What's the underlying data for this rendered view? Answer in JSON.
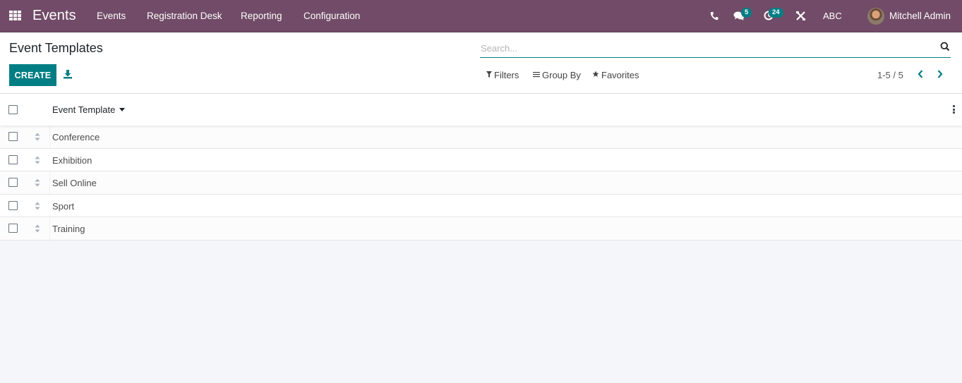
{
  "navbar": {
    "brand": "Events",
    "menu": [
      "Events",
      "Registration Desk",
      "Reporting",
      "Configuration"
    ],
    "messages_badge": "5",
    "activities_badge": "24",
    "company": "ABC",
    "user_name": "Mitchell Admin",
    "icons": [
      "apps-grid-icon",
      "phone-icon",
      "chat-icon",
      "clock-icon",
      "tools-icon"
    ]
  },
  "control_panel": {
    "title": "Event Templates",
    "create_label": "CREATE",
    "download_icon": "download-icon",
    "search": {
      "placeholder": "Search...",
      "value": ""
    },
    "filters_label": "Filters",
    "group_by_label": "Group By",
    "favorites_label": "Favorites",
    "pager_value": "1-5 / 5"
  },
  "list": {
    "columns": [
      {
        "label": "Event Template",
        "sorted": "desc"
      }
    ],
    "rows": [
      {
        "name": "Conference"
      },
      {
        "name": "Exhibition"
      },
      {
        "name": "Sell Online"
      },
      {
        "name": "Sport"
      },
      {
        "name": "Training"
      }
    ]
  },
  "colors": {
    "navbar": "#714b67",
    "primary": "#017e84",
    "background": "#f5f6f9"
  }
}
